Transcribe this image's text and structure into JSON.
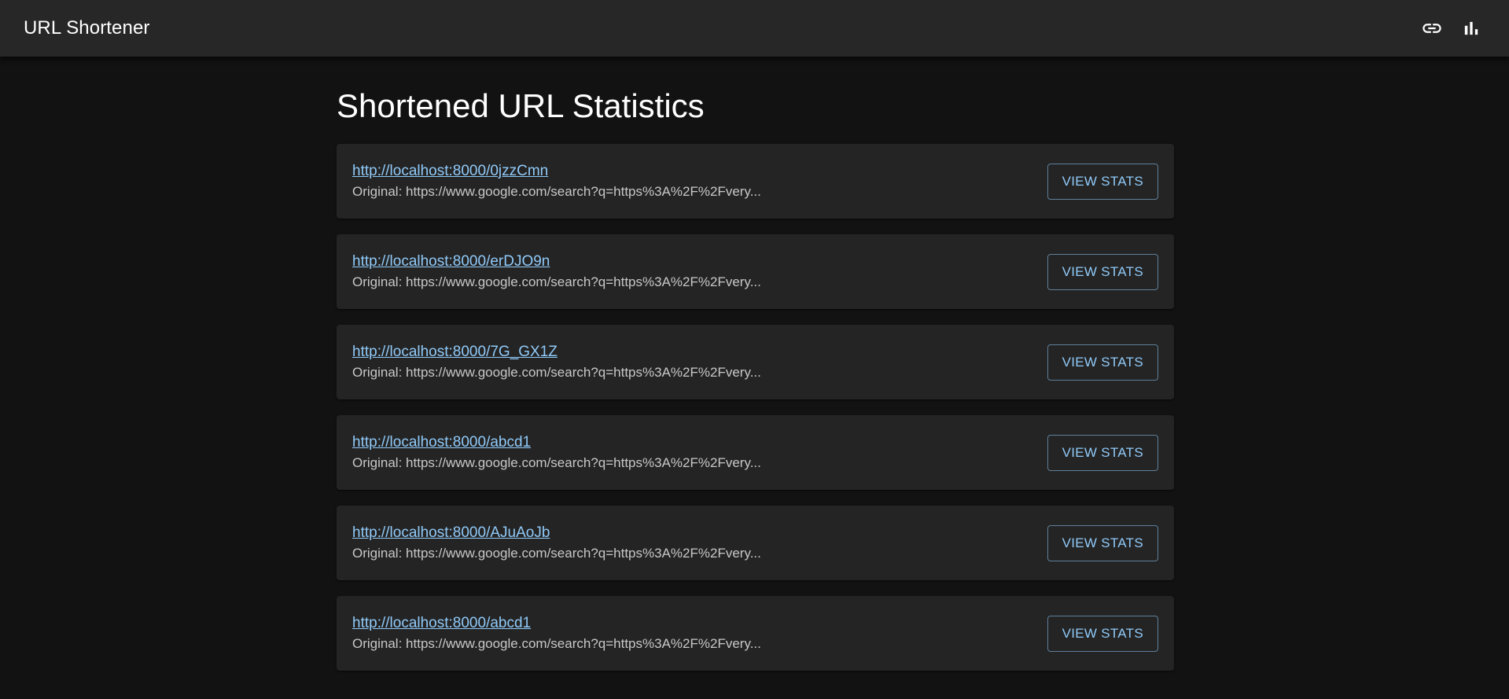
{
  "app": {
    "title": "URL Shortener",
    "icons": [
      "link-icon",
      "bar-chart-icon"
    ]
  },
  "page": {
    "title": "Shortened URL Statistics"
  },
  "urls": [
    {
      "short": "http://localhost:8000/0jzzCmn",
      "original_prefix": "Original:",
      "original": "https://www.google.com/search?q=https%3A%2F%2Fvery...",
      "button": "VIEW STATS"
    },
    {
      "short": "http://localhost:8000/erDJO9n",
      "original_prefix": "Original:",
      "original": "https://www.google.com/search?q=https%3A%2F%2Fvery...",
      "button": "VIEW STATS"
    },
    {
      "short": "http://localhost:8000/7G_GX1Z",
      "original_prefix": "Original:",
      "original": "https://www.google.com/search?q=https%3A%2F%2Fvery...",
      "button": "VIEW STATS"
    },
    {
      "short": "http://localhost:8000/abcd1",
      "original_prefix": "Original:",
      "original": "https://www.google.com/search?q=https%3A%2F%2Fvery...",
      "button": "VIEW STATS"
    },
    {
      "short": "http://localhost:8000/AJuAoJb",
      "original_prefix": "Original:",
      "original": "https://www.google.com/search?q=https%3A%2F%2Fvery...",
      "button": "VIEW STATS"
    },
    {
      "short": "http://localhost:8000/abcd1",
      "original_prefix": "Original:",
      "original": "https://www.google.com/search?q=https%3A%2F%2Fvery...",
      "button": "VIEW STATS"
    }
  ],
  "colors": {
    "background": "#121212",
    "appbar": "#272727",
    "card": "#242424",
    "link": "#90caf9",
    "secondary_text": "#c8c8c8"
  }
}
